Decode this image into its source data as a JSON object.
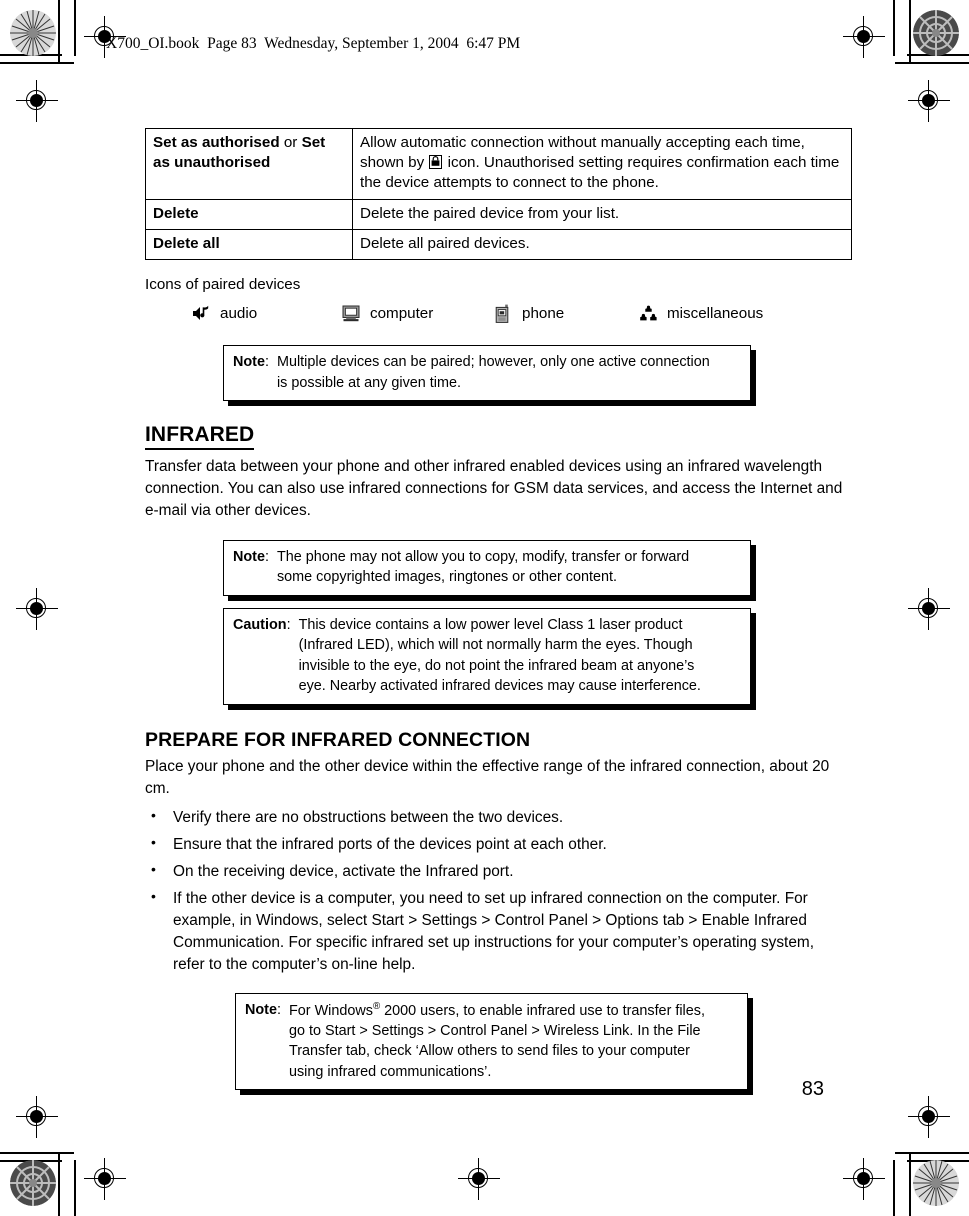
{
  "header": {
    "text": "X700_OI.book  Page 83  Wednesday, September 1, 2004  6:47 PM"
  },
  "page_number": "83",
  "table": {
    "rows": [
      {
        "option_bold_1": "Set as authorised",
        "option_join": " or ",
        "option_bold_2": "Set as unauthorised",
        "description_part1": "Allow automatic connection without manually accepting each time, shown by ",
        "description_icon": "padlock-icon",
        "description_part2": " icon. Unauthorised setting requires confirmation each time the device attempts to connect to the phone."
      },
      {
        "option_bold_1": "Delete",
        "option_join": "",
        "option_bold_2": "",
        "description_part1": "Delete the paired device from your list.",
        "description_icon": "",
        "description_part2": ""
      },
      {
        "option_bold_1": "Delete all",
        "option_join": "",
        "option_bold_2": "",
        "description_part1": "Delete all paired devices.",
        "description_icon": "",
        "description_part2": ""
      }
    ]
  },
  "icons_section": {
    "caption": "Icons of paired devices",
    "items": [
      {
        "icon": "audio-speaker-note-icon",
        "label": "audio"
      },
      {
        "icon": "computer-monitor-icon",
        "label": "computer"
      },
      {
        "icon": "mobile-phone-icon",
        "label": "phone"
      },
      {
        "icon": "miscellaneous-cluster-icon",
        "label": "miscellaneous"
      }
    ]
  },
  "note_paired": {
    "label": "Note",
    "colon": ":",
    "line1": "Multiple devices can be paired; however, only one active connection",
    "line2": "is possible at any given time."
  },
  "infrared": {
    "heading": "INFRARED",
    "paragraph": "Transfer data between your phone and other infrared enabled devices using an infrared wavelength connection. You can also use infrared connections for GSM data services, and access the Internet and e-mail via other devices."
  },
  "note_copyright": {
    "label": "Note",
    "colon": ":",
    "line1": "The phone may not allow you to copy, modify, transfer or forward",
    "line2": "some copyrighted images, ringtones or other content."
  },
  "caution_laser": {
    "label": "Caution",
    "colon": ":",
    "line1": "This device contains a low power level Class 1 laser product",
    "line2": "(Infrared LED), which will not normally harm the eyes. Though",
    "line3": "invisible to the eye, do not point the infrared beam at anyone’s",
    "line4": "eye. Nearby activated infrared devices may cause interference."
  },
  "prepare": {
    "heading": "PREPARE FOR INFRARED CONNECTION",
    "paragraph": "Place your phone and the other device within the effective range of the infrared connection, about 20 cm.",
    "bullets": [
      "Verify there are no obstructions between the two devices.",
      "Ensure that the infrared ports of the devices point at each other.",
      "On the receiving device, activate the Infrared port.",
      "If the other device is a computer, you need to set up infrared connection on the computer. For example, in Windows, select Start > Settings > Control Panel > Options tab > Enable Infrared Communication. For specific infrared set up instructions for your computer’s operating system, refer to the computer’s on-line help."
    ]
  },
  "note_windows": {
    "label": "Note",
    "colon": ":",
    "line1_pre": "For Windows",
    "line1_sup": "®",
    "line1_post": " 2000 users, to enable infrared use to transfer files,",
    "line2": "go to Start > Settings > Control Panel > Wireless Link. In the File",
    "line3": "Transfer tab, check ‘Allow others to send files to your computer",
    "line4": "using infrared communications’."
  },
  "colors": {
    "ink": "#000000",
    "paper": "#ffffff"
  }
}
